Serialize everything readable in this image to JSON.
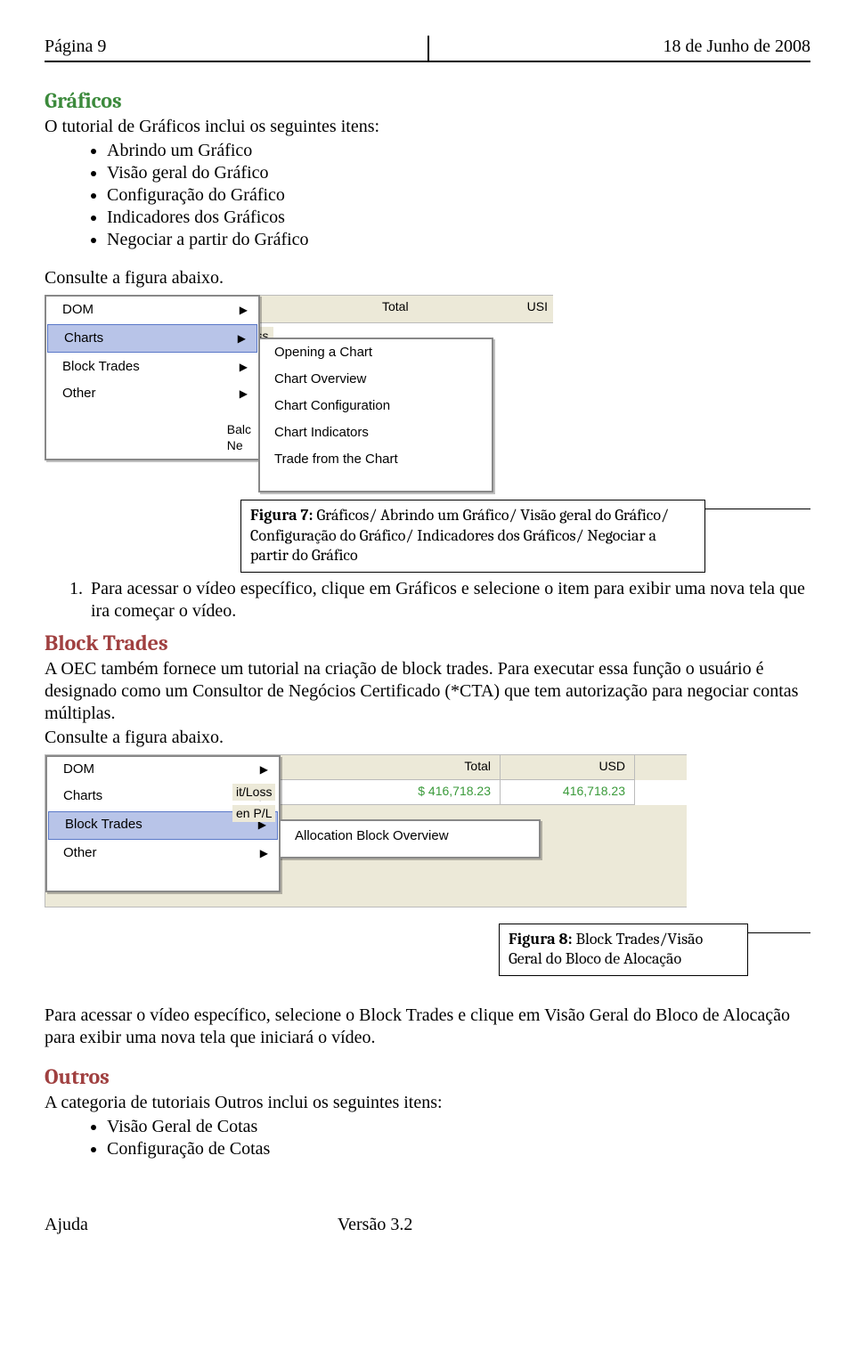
{
  "header": {
    "page": "Página 9",
    "date": "18 de Junho de 2008"
  },
  "sec1": {
    "title": "Gráficos",
    "intro": "O tutorial de Gráficos inclui os seguintes itens:",
    "bullets": [
      "Abrindo um Gráfico",
      "Visão geral do Gráfico",
      "Configuração do Gráfico",
      "Indicadores dos Gráficos",
      "Negociar a partir do Gráfico"
    ],
    "consult": "Consulte a figura abaixo."
  },
  "fig1": {
    "topbar": {
      "total": "Total",
      "usd": "USI"
    },
    "itloss": "it/Loss",
    "leftmenu": [
      "DOM",
      "Charts",
      "Block Trades",
      "Other"
    ],
    "bottom": {
      "a": "Balc",
      "b": "Ne"
    },
    "rightmenu": [
      "Opening a Chart",
      "Chart Overview",
      "Chart Configuration",
      "Chart Indicators",
      "Trade from the Chart"
    ]
  },
  "caption1": {
    "title": "Figura 7: ",
    "text": "Gráficos/ Abrindo um Gráfico/ Visão geral do Gráfico/ Configuração do Gráfico/ Indicadores dos Gráficos/ Negociar a partir do Gráfico"
  },
  "step1": "Para acessar o vídeo específico, clique em Gráficos e selecione o item para exibir uma nova tela que ira começar o vídeo.",
  "sec2": {
    "title": "Block Trades",
    "body": "A OEC também fornece um tutorial na criação de block trades. Para executar essa função o usuário é designado como um Consultor de Negócios Certificado (*CTA) que tem autorização para negociar contas múltiplas.",
    "consult": "Consulte a figura abaixo."
  },
  "fig2": {
    "header": {
      "total": "Total",
      "usd": "USD"
    },
    "row": {
      "v1": "$ 416,718.23",
      "v2": "416,718.23"
    },
    "itloss": "it/Loss",
    "enpl": "en P/L",
    "leftmenu": [
      "DOM",
      "Charts",
      "Block Trades",
      "Other"
    ],
    "submenu": "Allocation Block Overview"
  },
  "caption2": {
    "title": "Figura 8: ",
    "text": "Block Trades/Visão Geral do Bloco de Alocação"
  },
  "after2": "Para acessar o vídeo específico, selecione o Block Trades e clique em Visão Geral do Bloco de Alocação para exibir uma nova tela que iniciará o vídeo.",
  "sec3": {
    "title": "Outros",
    "intro": "A categoria de tutoriais Outros inclui os seguintes itens:",
    "bullets": [
      "Visão Geral de Cotas",
      "Configuração de Cotas"
    ]
  },
  "footer": {
    "left": "Ajuda",
    "right": "Versão 3.2"
  }
}
